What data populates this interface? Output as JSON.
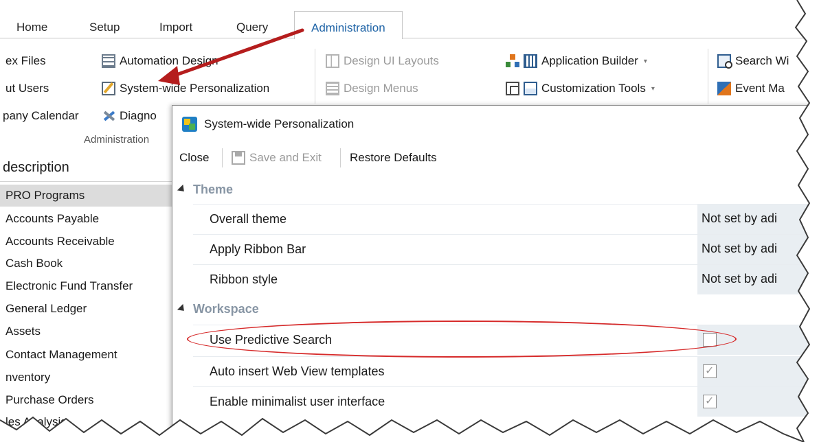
{
  "ribbon_tabs": [
    {
      "label": "Home"
    },
    {
      "label": "Setup"
    },
    {
      "label": "Import"
    },
    {
      "label": "Query"
    },
    {
      "label": "Administration",
      "active": true
    }
  ],
  "ribbon": {
    "col1": [
      "ex Files",
      "ut Users",
      "pany Calendar"
    ],
    "col2": {
      "automation_design": "Automation Design",
      "system_wide_personalization": "System-wide Personalization",
      "diagnostics": "Diagno"
    },
    "group_caption": "Administration",
    "col3": {
      "design_ui_layouts": "Design UI Layouts",
      "design_menus": "Design Menus"
    },
    "col4": {
      "application_builder": "Application Builder",
      "customization_tools": "Customization Tools"
    },
    "col5": {
      "search": "Search Wi",
      "event": "Event Ma"
    }
  },
  "left_list": {
    "header": "description",
    "items": [
      {
        "label": "PRO Programs",
        "selected": true
      },
      {
        "label": "Accounts Payable"
      },
      {
        "label": "Accounts Receivable"
      },
      {
        "label": "Cash Book"
      },
      {
        "label": "Electronic Fund Transfer"
      },
      {
        "label": "General Ledger"
      },
      {
        "label": "Assets"
      },
      {
        "label": "Contact Management"
      },
      {
        "label": "nventory"
      },
      {
        "label": "Purchase Orders"
      },
      {
        "label": "les Analysis"
      }
    ]
  },
  "dialog": {
    "title": "System-wide Personalization",
    "toolbar": {
      "close": "Close",
      "save_and_exit": "Save and Exit",
      "restore_defaults": "Restore Defaults"
    },
    "sections": [
      {
        "title": "Theme",
        "rows": [
          {
            "label": "Overall theme",
            "value": "Not set by adi"
          },
          {
            "label": "Apply Ribbon Bar",
            "value": "Not set by adi"
          },
          {
            "label": "Ribbon style",
            "value": "Not set by adi"
          }
        ]
      },
      {
        "title": "Workspace",
        "rows": [
          {
            "label": "Use Predictive Search",
            "checked": false
          },
          {
            "label": "Auto insert Web View templates",
            "checked": true
          },
          {
            "label": "Enable minimalist user interface",
            "checked": true
          }
        ]
      }
    ]
  },
  "colors": {
    "accent": "#1e63a6",
    "annotation_red": "#d62a2a",
    "value_cell_bg": "#e9eef2",
    "section_title": "#8795a4"
  },
  "icons": {
    "automation_design": "grid-icon",
    "personalization": "pencil-icon",
    "diagnostics": "tools-icon",
    "design_ui_layouts": "layout-icon",
    "design_menus": "menu-icon",
    "application_builder": "tree-icon",
    "customization_tools": "custom-icon",
    "search": "search-icon",
    "event": "event-icon",
    "dialog": "app-icon",
    "save": "save-icon"
  }
}
